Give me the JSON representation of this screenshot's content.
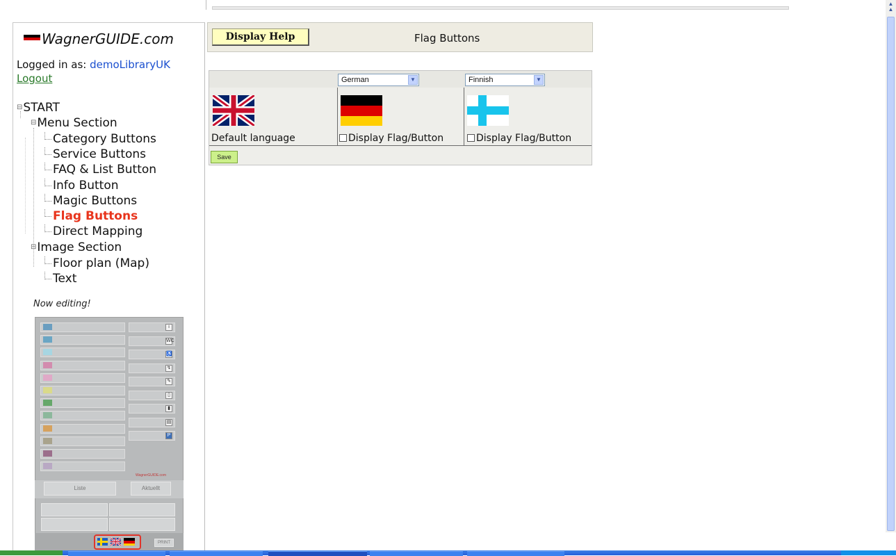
{
  "sidebar": {
    "logo_text": "WagnerGUIDE.com",
    "logged_in_label": "Logged in as:",
    "username": "demoLibraryUK",
    "logout_label": "Logout",
    "tree": {
      "root": "START",
      "menu_section": {
        "label": "Menu Section",
        "items": [
          "Category Buttons",
          "Service Buttons",
          "FAQ & List Button",
          "Info Button",
          "Magic Buttons",
          "Flag Buttons",
          "Direct Mapping"
        ],
        "active_item": "Flag Buttons"
      },
      "image_section": {
        "label": "Image Section",
        "items": [
          "Floor plan (Map)",
          "Text"
        ]
      }
    },
    "now_editing_label": "Now editing!",
    "preview": {
      "list_button": "Liste",
      "current_button": "Aktuellt",
      "print_button": "PRINT",
      "watermark": "WagnerGUIDE.com",
      "swatches": [
        "#6a9ec0",
        "#6aa6c4",
        "#a7d6e2",
        "#d38cae",
        "#e0a9c7",
        "#dada8a",
        "#66a86a",
        "#8cb89c",
        "#d6a25e",
        "#a9a38c",
        "#9c6f8c",
        "#b9a9c4"
      ],
      "icons": [
        "i",
        "WC",
        "♿",
        "↯",
        "✎",
        "▯",
        "▮",
        "▤",
        "P"
      ]
    }
  },
  "header": {
    "help_button": "Display Help",
    "title": "Flag Buttons"
  },
  "flags": {
    "columns": [
      {
        "language": "",
        "flag": "uk-flag",
        "label": "Default language",
        "checkbox": false
      },
      {
        "language": "German",
        "flag": "germany-flag",
        "label": "Display Flag/Button",
        "checkbox": true
      },
      {
        "language": "Finnish",
        "flag": "finland-flag",
        "label": "Display Flag/Button",
        "checkbox": true
      }
    ],
    "save_label": "Save"
  }
}
